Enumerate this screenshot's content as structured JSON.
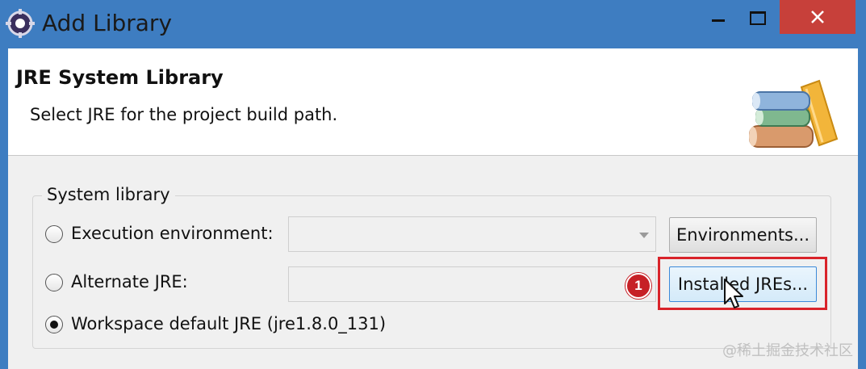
{
  "window": {
    "title": "Add Library",
    "app_icon": "eclipse-gear-icon",
    "controls": [
      "minimize-icon",
      "maximize-icon",
      "close-icon"
    ],
    "colors": {
      "titlebar": "#3e7dc1",
      "close": "#c7403a"
    }
  },
  "header": {
    "title": "JRE System Library",
    "description": "Select JRE for the project build path.",
    "icon": "library-books-icon"
  },
  "system_library": {
    "group_label": "System library",
    "options": [
      {
        "label": "Execution environment:",
        "selected": false
      },
      {
        "label": "Alternate JRE:",
        "selected": false
      },
      {
        "label": "Workspace default JRE (jre1.8.0_131)",
        "selected": true
      }
    ],
    "environments_button": "Environments...",
    "installed_jres_button": "Installed JREs..."
  },
  "annotation": {
    "step_number": "1",
    "highlight_color": "#d9232a"
  },
  "watermark": "@稀土掘金技术社区"
}
